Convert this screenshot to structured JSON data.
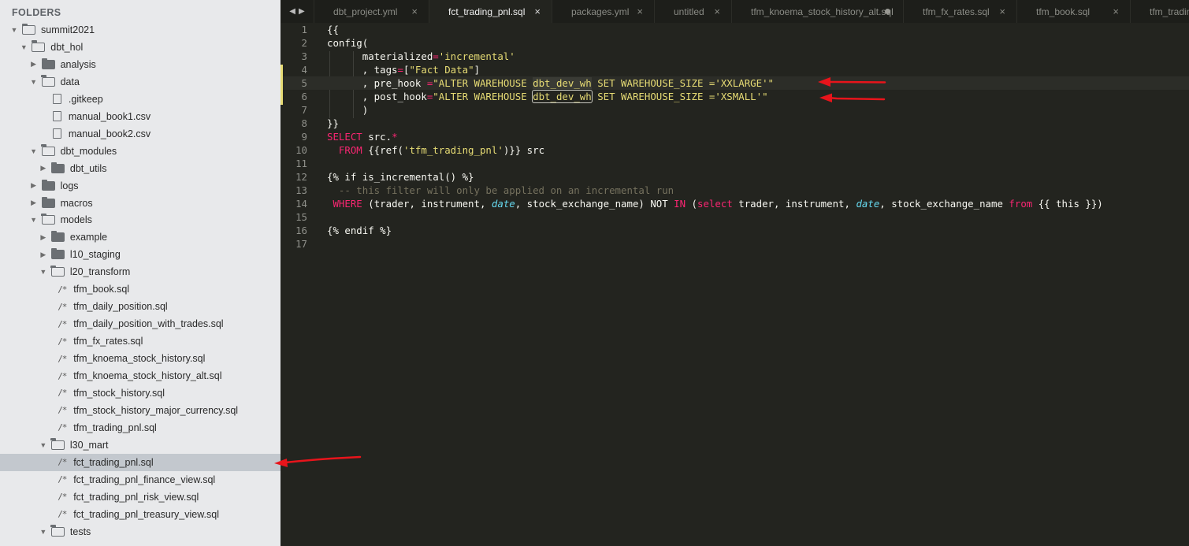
{
  "sidebar": {
    "title": "FOLDERS",
    "rows": [
      {
        "label": "summit2021",
        "type": "folder",
        "open": true,
        "indent": 0
      },
      {
        "label": "dbt_hol",
        "type": "folder",
        "open": true,
        "indent": 1
      },
      {
        "label": "analysis",
        "type": "folder",
        "open": false,
        "indent": 2
      },
      {
        "label": "data",
        "type": "folder",
        "open": true,
        "indent": 2
      },
      {
        "label": ".gitkeep",
        "type": "file",
        "indent": 3
      },
      {
        "label": "manual_book1.csv",
        "type": "file",
        "indent": 3
      },
      {
        "label": "manual_book2.csv",
        "type": "file",
        "indent": 3
      },
      {
        "label": "dbt_modules",
        "type": "folder",
        "open": true,
        "indent": 2
      },
      {
        "label": "dbt_utils",
        "type": "folder",
        "open": false,
        "indent": 3
      },
      {
        "label": "logs",
        "type": "folder",
        "open": false,
        "indent": 2
      },
      {
        "label": "macros",
        "type": "folder",
        "open": false,
        "indent": 2
      },
      {
        "label": "models",
        "type": "folder",
        "open": true,
        "indent": 2
      },
      {
        "label": "example",
        "type": "folder",
        "open": false,
        "indent": 3
      },
      {
        "label": "l10_staging",
        "type": "folder",
        "open": false,
        "indent": 3
      },
      {
        "label": "l20_transform",
        "type": "folder",
        "open": true,
        "indent": 3
      },
      {
        "label": "tfm_book.sql",
        "type": "sql",
        "indent": 4
      },
      {
        "label": "tfm_daily_position.sql",
        "type": "sql",
        "indent": 4
      },
      {
        "label": "tfm_daily_position_with_trades.sql",
        "type": "sql",
        "indent": 4
      },
      {
        "label": "tfm_fx_rates.sql",
        "type": "sql",
        "indent": 4
      },
      {
        "label": "tfm_knoema_stock_history.sql",
        "type": "sql",
        "indent": 4
      },
      {
        "label": "tfm_knoema_stock_history_alt.sql",
        "type": "sql",
        "indent": 4
      },
      {
        "label": "tfm_stock_history.sql",
        "type": "sql",
        "indent": 4
      },
      {
        "label": "tfm_stock_history_major_currency.sql",
        "type": "sql",
        "indent": 4
      },
      {
        "label": "tfm_trading_pnl.sql",
        "type": "sql",
        "indent": 4
      },
      {
        "label": "l30_mart",
        "type": "folder",
        "open": true,
        "indent": 3
      },
      {
        "label": "fct_trading_pnl.sql",
        "type": "sql",
        "indent": 4,
        "selected": true
      },
      {
        "label": "fct_trading_pnl_finance_view.sql",
        "type": "sql",
        "indent": 4
      },
      {
        "label": "fct_trading_pnl_risk_view.sql",
        "type": "sql",
        "indent": 4
      },
      {
        "label": "fct_trading_pnl_treasury_view.sql",
        "type": "sql",
        "indent": 4
      },
      {
        "label": "tests",
        "type": "folder",
        "open": true,
        "indent": 3
      }
    ]
  },
  "tabs": [
    {
      "label": "dbt_project.yml",
      "active": false,
      "marker": "close"
    },
    {
      "label": "fct_trading_pnl.sql",
      "active": true,
      "marker": "close"
    },
    {
      "label": "packages.yml",
      "active": false,
      "marker": "close"
    },
    {
      "label": "untitled",
      "active": false,
      "marker": "close"
    },
    {
      "label": "tfm_knoema_stock_history_alt.sql",
      "active": false,
      "marker": "dot"
    },
    {
      "label": "tfm_fx_rates.sql",
      "active": false,
      "marker": "close"
    },
    {
      "label": "tfm_book.sql",
      "active": false,
      "marker": "close"
    },
    {
      "label": "tfm_tradin",
      "active": false,
      "marker": "none"
    }
  ],
  "tab_nav": {
    "prev": "◀",
    "next": "▶"
  },
  "close_glyph": "×",
  "editor": {
    "highlighted_line": 5,
    "lines": [
      {
        "n": "1",
        "tokens": [
          {
            "t": "{{"
          }
        ]
      },
      {
        "n": "2",
        "tokens": [
          {
            "t": "config("
          }
        ]
      },
      {
        "n": "3",
        "tokens": [
          {
            "t": "      materialized"
          },
          {
            "t": "=",
            "c": "kw"
          },
          {
            "t": "'incremental'",
            "c": "str"
          }
        ]
      },
      {
        "n": "4",
        "tokens": [
          {
            "t": "      , tags"
          },
          {
            "t": "=",
            "c": "kw"
          },
          {
            "t": "["
          },
          {
            "t": "\"Fact Data\"",
            "c": "str"
          },
          {
            "t": "]"
          }
        ]
      },
      {
        "n": "5",
        "tokens": [
          {
            "t": "      , pre_hook "
          },
          {
            "t": "=",
            "c": "kw"
          },
          {
            "t": "\"ALTER WAREHOUSE ",
            "c": "str"
          },
          {
            "t": "dbt_dev_wh",
            "c": "str",
            "box": "soft"
          },
          {
            "t": " SET WAREHOUSE_SIZE ='XXLARGE'\"",
            "c": "str"
          }
        ]
      },
      {
        "n": "6",
        "tokens": [
          {
            "t": "      , post_hook"
          },
          {
            "t": "=",
            "c": "kw"
          },
          {
            "t": "\"ALTER WAREHOUSE ",
            "c": "str"
          },
          {
            "t": "dbt_dev_wh",
            "c": "str",
            "box": "outline"
          },
          {
            "t": " SET WAREHOUSE_SIZE ='XSMALL'\"",
            "c": "str"
          }
        ]
      },
      {
        "n": "7",
        "tokens": [
          {
            "t": "      )"
          }
        ]
      },
      {
        "n": "8",
        "tokens": [
          {
            "t": "}}"
          }
        ]
      },
      {
        "n": "9",
        "tokens": [
          {
            "t": "SELECT",
            "c": "kw"
          },
          {
            "t": " src."
          },
          {
            "t": "*",
            "c": "kw"
          }
        ]
      },
      {
        "n": "10",
        "tokens": [
          {
            "t": "  "
          },
          {
            "t": "FROM",
            "c": "kw"
          },
          {
            "t": " {{ref("
          },
          {
            "t": "'tfm_trading_pnl'",
            "c": "str"
          },
          {
            "t": ")}} src"
          }
        ]
      },
      {
        "n": "11",
        "tokens": [
          {
            "t": ""
          }
        ]
      },
      {
        "n": "12",
        "tokens": [
          {
            "t": "{% if is_incremental() %}"
          }
        ]
      },
      {
        "n": "13",
        "tokens": [
          {
            "t": "  -- this filter will only be applied on an incremental run",
            "c": "cm"
          }
        ]
      },
      {
        "n": "14",
        "tokens": [
          {
            "t": " "
          },
          {
            "t": "WHERE",
            "c": "kw"
          },
          {
            "t": " (trader, instrument, "
          },
          {
            "t": "date",
            "c": "it"
          },
          {
            "t": ", stock_exchange_name) NOT "
          },
          {
            "t": "IN",
            "c": "kw"
          },
          {
            "t": " ("
          },
          {
            "t": "select",
            "c": "kw"
          },
          {
            "t": " trader, instrument, "
          },
          {
            "t": "date",
            "c": "it"
          },
          {
            "t": ", stock_exchange_name "
          },
          {
            "t": "from",
            "c": "kw"
          },
          {
            "t": " {{ this }})"
          }
        ]
      },
      {
        "n": "15",
        "tokens": [
          {
            "t": ""
          }
        ]
      },
      {
        "n": "16",
        "tokens": [
          {
            "t": "{% endif %}"
          }
        ]
      },
      {
        "n": "17",
        "tokens": [
          {
            "t": ""
          }
        ]
      }
    ]
  },
  "colors": {
    "annotation_arrow": "#e8141b",
    "editor_bg": "#23241f",
    "sidebar_bg": "#e8e9eb",
    "keyword": "#f92672",
    "string": "#e6db74",
    "builtin": "#66d9ef",
    "comment": "#75715e"
  }
}
